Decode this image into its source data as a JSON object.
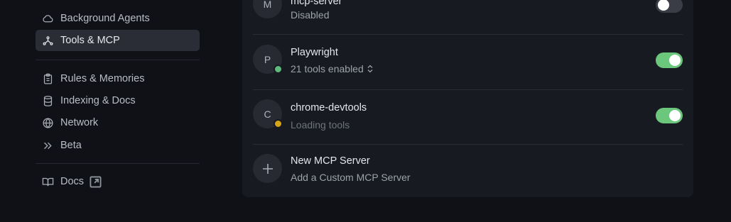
{
  "sidebar": {
    "items": [
      {
        "label": "Background Agents",
        "icon": "cloud-icon"
      },
      {
        "label": "Tools & MCP",
        "icon": "tools-mcp-icon",
        "active": true
      },
      {
        "label": "Rules & Memories",
        "icon": "clipboard-icon"
      },
      {
        "label": "Indexing & Docs",
        "icon": "database-icon"
      },
      {
        "label": "Network",
        "icon": "globe-icon"
      },
      {
        "label": "Beta",
        "icon": "double-chevron-icon"
      },
      {
        "label": "Docs",
        "icon": "book-icon"
      }
    ]
  },
  "servers": [
    {
      "initial": "M",
      "name": "mcp-server",
      "status": "Disabled",
      "enabled": false
    },
    {
      "initial": "P",
      "name": "Playwright",
      "status": "21 tools enabled",
      "enabled": true,
      "dot_color": "#5fba7d"
    },
    {
      "initial": "C",
      "name": "chrome-devtools",
      "status": "Loading tools",
      "enabled": true,
      "dot_color": "#d4a514"
    }
  ],
  "new_server": {
    "title": "New MCP Server",
    "subtitle": "Add a Custom MCP Server"
  },
  "colors": {
    "toggle_on": "#6bc77c",
    "toggle_off": "#3a3d45"
  }
}
